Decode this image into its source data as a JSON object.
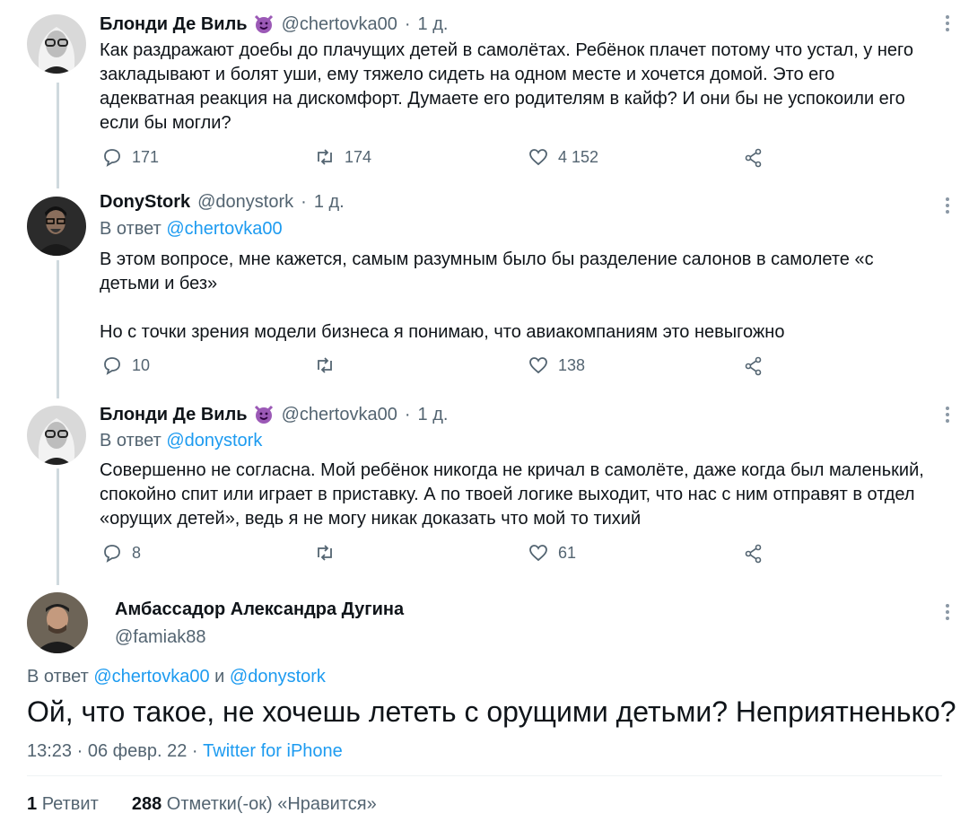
{
  "tweets": [
    {
      "name": "Блонди Де Виль",
      "handle": "@chertovka00",
      "time": "1 д.",
      "reply_prefix": "",
      "reply_to": "",
      "text": "Как раздражают доебы до плачущих детей в самолётах. Ребёнок плачет потому что устал, у него закладывают и болят уши, ему тяжело сидеть на одном месте и хочется домой. Это его адекватная реакция на дискомфорт. Думаете его родителям в кайф? И они бы не успокоили его если бы могли?",
      "replies": "171",
      "retweets": "174",
      "likes": "4 152"
    },
    {
      "name": "DonyStork",
      "handle": "@donystork",
      "time": "1 д.",
      "reply_prefix": "В ответ",
      "reply_to": "@chertovka00",
      "text": "В этом вопросе, мне кажется, самым разумным было бы разделение салонов в самолете «с детьми и без»\n\nНо с точки зрения модели бизнеса я понимаю, что авиакомпаниям это невыгожно",
      "replies": "10",
      "retweets": "",
      "likes": "138"
    },
    {
      "name": "Блонди Де Виль",
      "handle": "@chertovka00",
      "time": "1 д.",
      "reply_prefix": "В ответ",
      "reply_to": "@donystork",
      "text": "Совершенно не согласна. Мой ребёнок никогда не кричал в самолёте, даже когда был маленький, спокойно спит или играет в приставку. А по твоей логике выходит, что нас с ним отправят в отдел «орущих детей», ведь я не могу никак доказать что мой то тихий",
      "replies": "8",
      "retweets": "",
      "likes": "61"
    }
  ],
  "main": {
    "name": "Амбассадор Александра Дугина",
    "handle": "@famiak88",
    "reply_prefix": "В ответ",
    "reply_to_1": "@chertovka00",
    "reply_and": "и",
    "reply_to_2": "@donystork",
    "text": "Ой, что такое, не хочешь лететь с орущими детьми? Неприятненько?",
    "time": "13:23",
    "date": "06 февр. 22",
    "source": "Twitter for iPhone",
    "retweets_count": "1",
    "retweets_label": "Ретвит",
    "likes_count": "288",
    "likes_label": "Отметки(-ок) «Нравится»"
  },
  "colors": {
    "link": "#1d9bf0",
    "secondary": "#536471",
    "line": "#cfd9de"
  },
  "icons": [
    "reply-icon",
    "retweet-icon",
    "like-icon",
    "share-icon",
    "more-icon",
    "devil-emoji-icon"
  ]
}
